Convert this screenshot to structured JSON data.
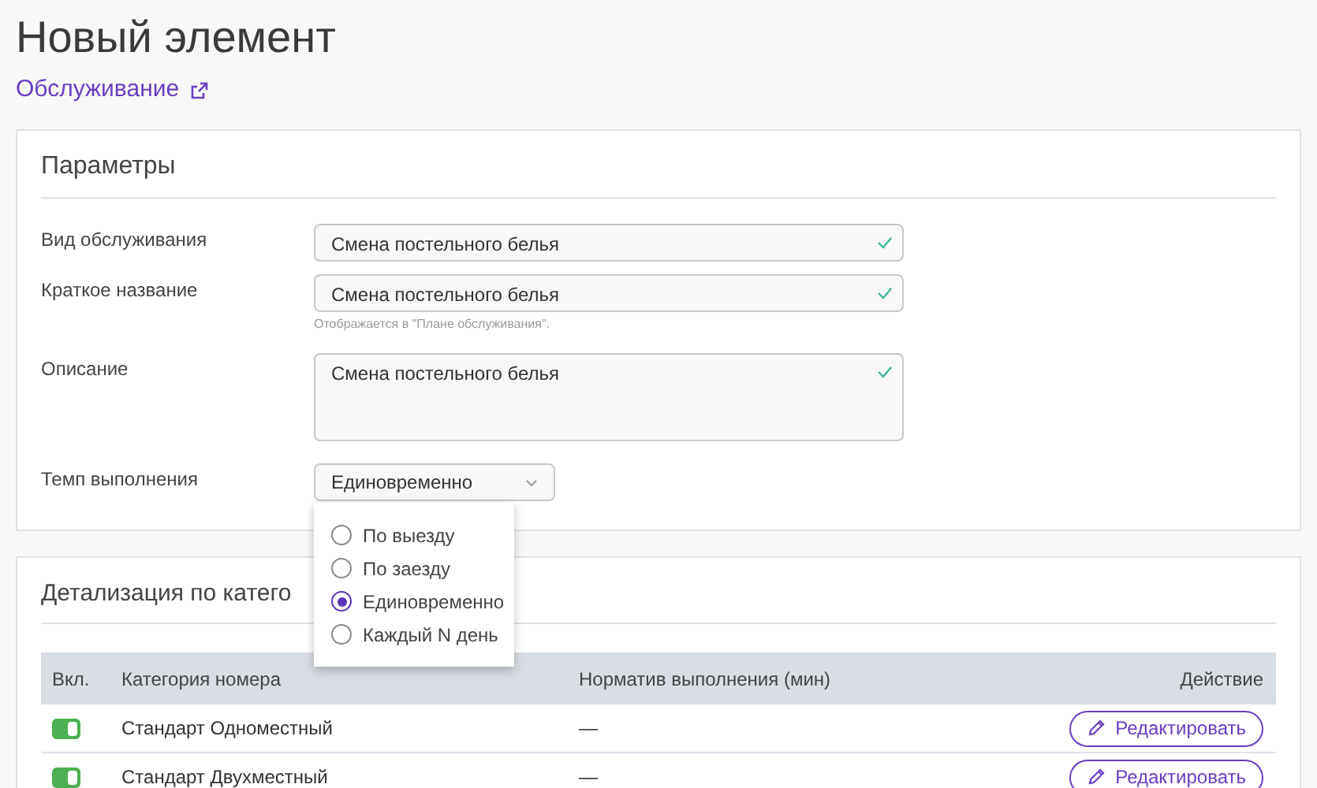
{
  "title": "Новый элемент",
  "link": "Обслуживание",
  "parameters": {
    "heading": "Параметры",
    "fields": [
      {
        "kind": "input",
        "label": "Вид обслуживания",
        "value": "Смена постельного белья",
        "valid": true
      },
      {
        "kind": "input",
        "label": "Краткое название",
        "value": "Смена постельного белья",
        "valid": true,
        "hint": "Отображается в \"Плане обслуживания\"."
      },
      {
        "kind": "textarea",
        "label": "Описание",
        "value": "Смена постельного белья",
        "valid": true
      },
      {
        "kind": "select",
        "label": "Темп выполнения",
        "value": "Единовременно",
        "expanded": true,
        "options": [
          {
            "label": "По выезду",
            "selected": false
          },
          {
            "label": "По заезду",
            "selected": false
          },
          {
            "label": "Единовременно",
            "selected": true
          },
          {
            "label": "Каждый N день",
            "selected": false
          }
        ]
      }
    ]
  },
  "details": {
    "heading": "Детализация по катего",
    "columns": [
      "Вкл.",
      "Категория номера",
      "Норматив выполнения (мин)",
      "Действие"
    ],
    "rows": [
      {
        "on": true,
        "category": "Стандарт Одноместный",
        "norm": "—",
        "action": "Редактировать"
      },
      {
        "on": true,
        "category": "Стандарт Двухместный",
        "norm": "—",
        "action": "Редактировать"
      }
    ]
  }
}
